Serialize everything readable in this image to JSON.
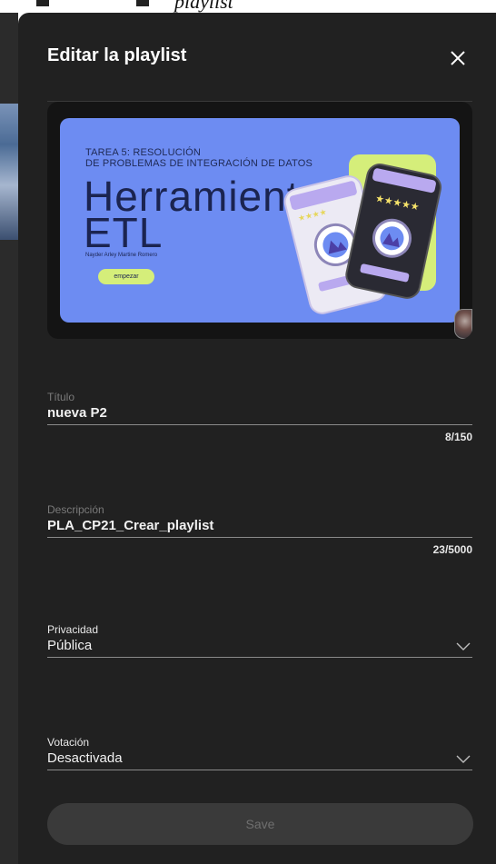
{
  "background": {
    "cut_text": "playlist"
  },
  "dialog": {
    "title": "Editar la playlist",
    "close_icon": "close-icon"
  },
  "thumbnail": {
    "subtitle_line1": "TAREA 5: RESOLUCIÓN",
    "subtitle_line2": "DE PROBLEMAS DE INTEGRACIÓN DE DATOS",
    "headline_line1": "Herramientas",
    "headline_line2": "ETL",
    "author": "Nayder Arley Martine Romero",
    "start_label": "empezar",
    "rating_stars": "★★★★★",
    "rating_stars_alt": "★★★★"
  },
  "fields": {
    "title": {
      "label": "Título",
      "value": "nueva P2",
      "counter": "8/150"
    },
    "description": {
      "label": "Descripción",
      "value": "PLA_CP21_Crear_playlist",
      "counter": "23/5000"
    },
    "privacy": {
      "label": "Privacidad",
      "value": "Pública",
      "icon": "chevron-down-icon"
    },
    "voting": {
      "label": "Votación",
      "value": "Desactivada",
      "icon": "chevron-down-icon"
    }
  },
  "actions": {
    "save_label": "Save"
  },
  "colors": {
    "dialog_bg": "#212121",
    "thumbnail_bg": "#6d8cf2",
    "accent_green": "#d5ee7a",
    "save_bg": "#3a3a3a",
    "save_text": "#6f6f6f"
  }
}
